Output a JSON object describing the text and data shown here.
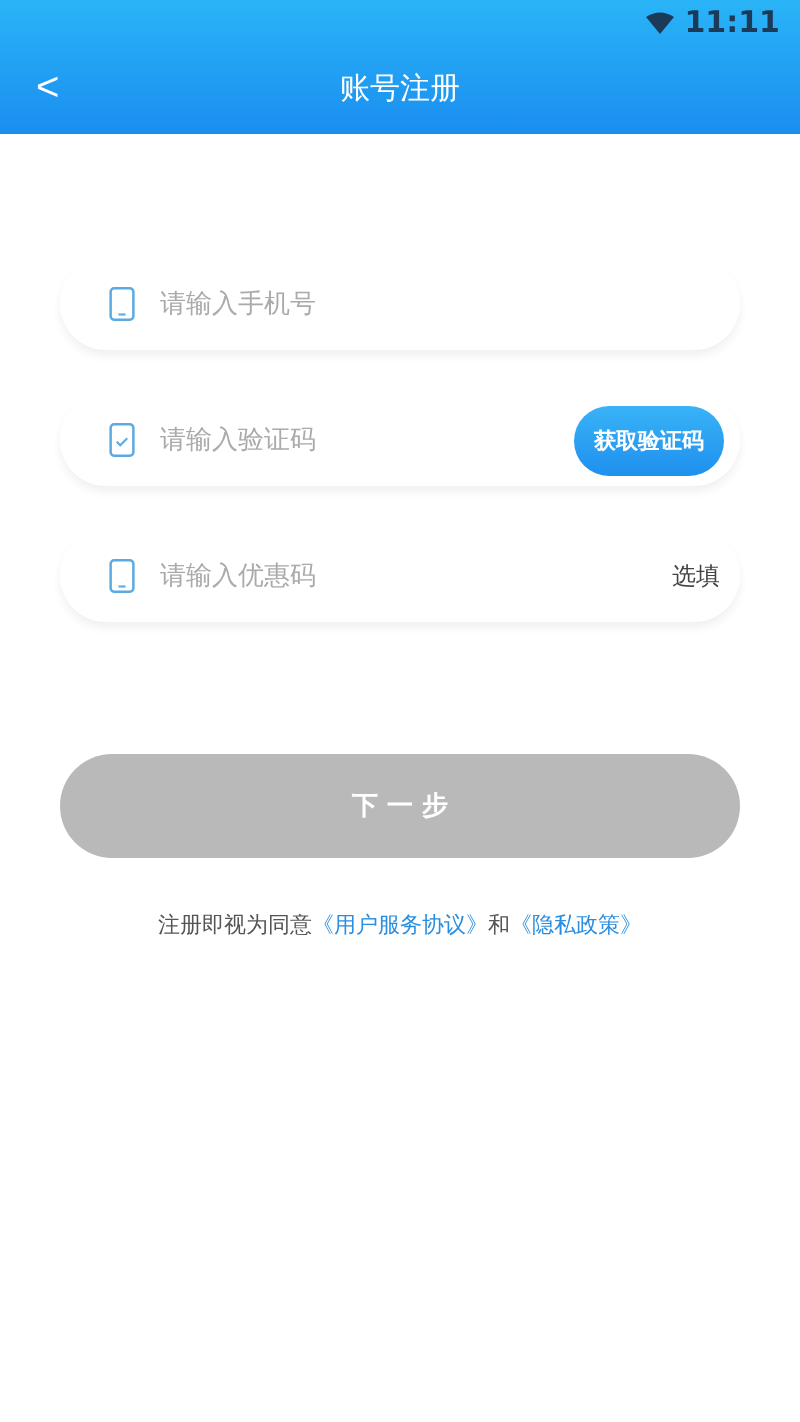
{
  "status_bar": {
    "time": "11:11"
  },
  "header": {
    "back": "<",
    "title": "账号注册"
  },
  "fields": [
    {
      "kind": "phone",
      "placeholder": "请输入手机号"
    },
    {
      "kind": "code",
      "placeholder": "请输入验证码",
      "action": "获取验证码"
    },
    {
      "kind": "coupon",
      "placeholder": "请输入优惠码",
      "suffix": "选填"
    }
  ],
  "next_button": {
    "label": "下 一 步",
    "disabled": true
  },
  "agreement": [
    {
      "kind": "text",
      "text": "注册即视为同意"
    },
    {
      "kind": "link",
      "text": "《用户服务协议》"
    },
    {
      "kind": "text",
      "text": "和"
    },
    {
      "kind": "link",
      "text": "《隐私政策》"
    }
  ]
}
